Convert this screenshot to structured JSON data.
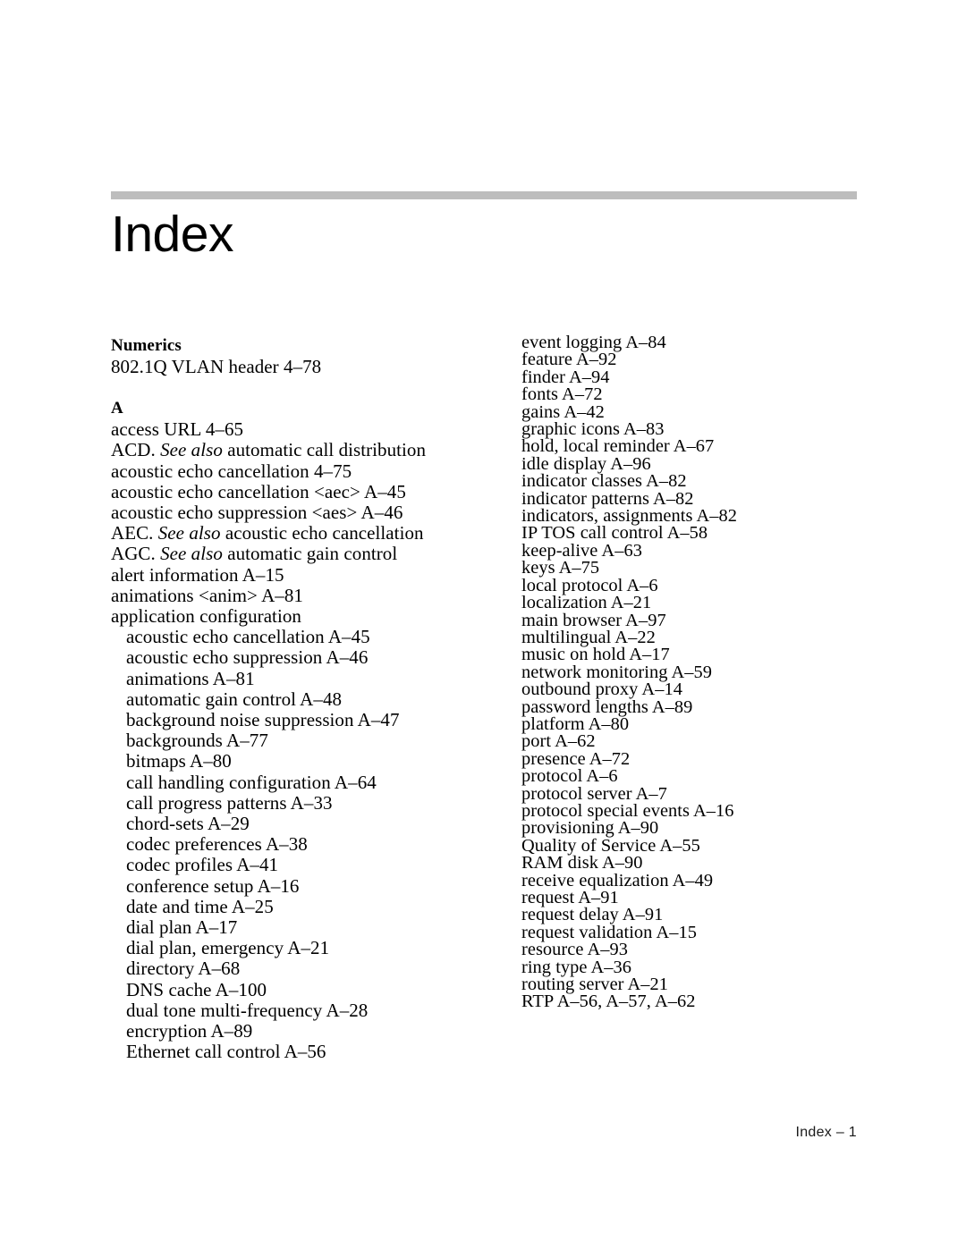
{
  "document": {
    "title": "Index",
    "footer": "Index – 1",
    "rule_color": "#bdbdbd"
  },
  "columns": {
    "left": {
      "numerics": {
        "heading": "Numerics",
        "entries": [
          {
            "text": "802.1Q VLAN header 4–78",
            "level": 0
          }
        ]
      },
      "a": {
        "heading": "A",
        "entries": [
          {
            "text": "access URL 4–65",
            "level": 0
          },
          {
            "prefix": "ACD. ",
            "italic": "See also",
            "suffix": " automatic call distribution",
            "level": 0
          },
          {
            "text": "acoustic echo cancellation 4–75",
            "level": 0
          },
          {
            "text": "acoustic echo cancellation <aec> A–45",
            "level": 0
          },
          {
            "text": "acoustic echo suppression <aes> A–46",
            "level": 0
          },
          {
            "prefix": "AEC. ",
            "italic": "See also",
            "suffix": " acoustic echo cancellation",
            "level": 0
          },
          {
            "prefix": "AGC. ",
            "italic": "See also",
            "suffix": "  automatic gain control",
            "level": 0
          },
          {
            "text": "alert information A–15",
            "level": 0
          },
          {
            "text": "animations <anim> A–81",
            "level": 0
          },
          {
            "text": "application configuration",
            "level": 0
          },
          {
            "text": "acoustic echo cancellation A–45",
            "level": 1
          },
          {
            "text": "acoustic echo suppression A–46",
            "level": 1
          },
          {
            "text": "animations A–81",
            "level": 1
          },
          {
            "text": "automatic gain control A–48",
            "level": 1
          },
          {
            "text": "background noise suppression A–47",
            "level": 1
          },
          {
            "text": "backgrounds A–77",
            "level": 1
          },
          {
            "text": "bitmaps A–80",
            "level": 1
          },
          {
            "text": "call handling configuration A–64",
            "level": 1
          },
          {
            "text": "call progress patterns A–33",
            "level": 1
          },
          {
            "text": "chord-sets A–29",
            "level": 1
          },
          {
            "text": "codec preferences A–38",
            "level": 1
          },
          {
            "text": "codec profiles A–41",
            "level": 1
          },
          {
            "text": "conference setup A–16",
            "level": 1
          },
          {
            "text": "date and time A–25",
            "level": 1
          },
          {
            "text": "dial plan A–17",
            "level": 1
          },
          {
            "text": "dial plan, emergency A–21",
            "level": 1
          },
          {
            "text": "directory A–68",
            "level": 1
          },
          {
            "text": "DNS cache A–100",
            "level": 1
          },
          {
            "text": "dual tone multi-frequency A–28",
            "level": 1
          },
          {
            "text": "encryption A–89",
            "level": 1
          },
          {
            "text": "Ethernet call control A–56",
            "level": 1
          }
        ]
      }
    },
    "right": {
      "entries": [
        {
          "text": "event logging A–84"
        },
        {
          "text": "feature A–92"
        },
        {
          "text": "finder A–94"
        },
        {
          "text": "fonts A–72"
        },
        {
          "text": "gains A–42"
        },
        {
          "text": "graphic icons A–83"
        },
        {
          "text": "hold, local reminder A–67"
        },
        {
          "text": "idle display A–96"
        },
        {
          "text": "indicator classes A–82"
        },
        {
          "text": "indicator patterns A–82"
        },
        {
          "text": "indicators, assignments A–82"
        },
        {
          "text": "IP TOS call control A–58"
        },
        {
          "text": "keep-alive A–63"
        },
        {
          "text": "keys A–75"
        },
        {
          "text": "local protocol A–6"
        },
        {
          "text": "localization A–21"
        },
        {
          "text": "main browser A–97"
        },
        {
          "text": "multilingual A–22"
        },
        {
          "text": "music on hold A–17"
        },
        {
          "text": "network monitoring A–59"
        },
        {
          "text": "outbound proxy A–14"
        },
        {
          "text": "password lengths A–89"
        },
        {
          "text": "platform A–80"
        },
        {
          "text": "port A–62"
        },
        {
          "text": "presence A–72"
        },
        {
          "text": "protocol A–6"
        },
        {
          "text": "protocol server A–7"
        },
        {
          "text": "protocol special events A–16"
        },
        {
          "text": "provisioning A–90"
        },
        {
          "text": "Quality of Service A–55"
        },
        {
          "text": "RAM disk A–90"
        },
        {
          "text": "receive equalization A–49"
        },
        {
          "text": "request A–91"
        },
        {
          "text": "request delay A–91"
        },
        {
          "text": "request validation A–15"
        },
        {
          "text": "resource A–93"
        },
        {
          "text": "ring type A–36"
        },
        {
          "text": "routing server A–21"
        },
        {
          "text": "RTP A–56, A–57, A–62"
        }
      ]
    }
  }
}
